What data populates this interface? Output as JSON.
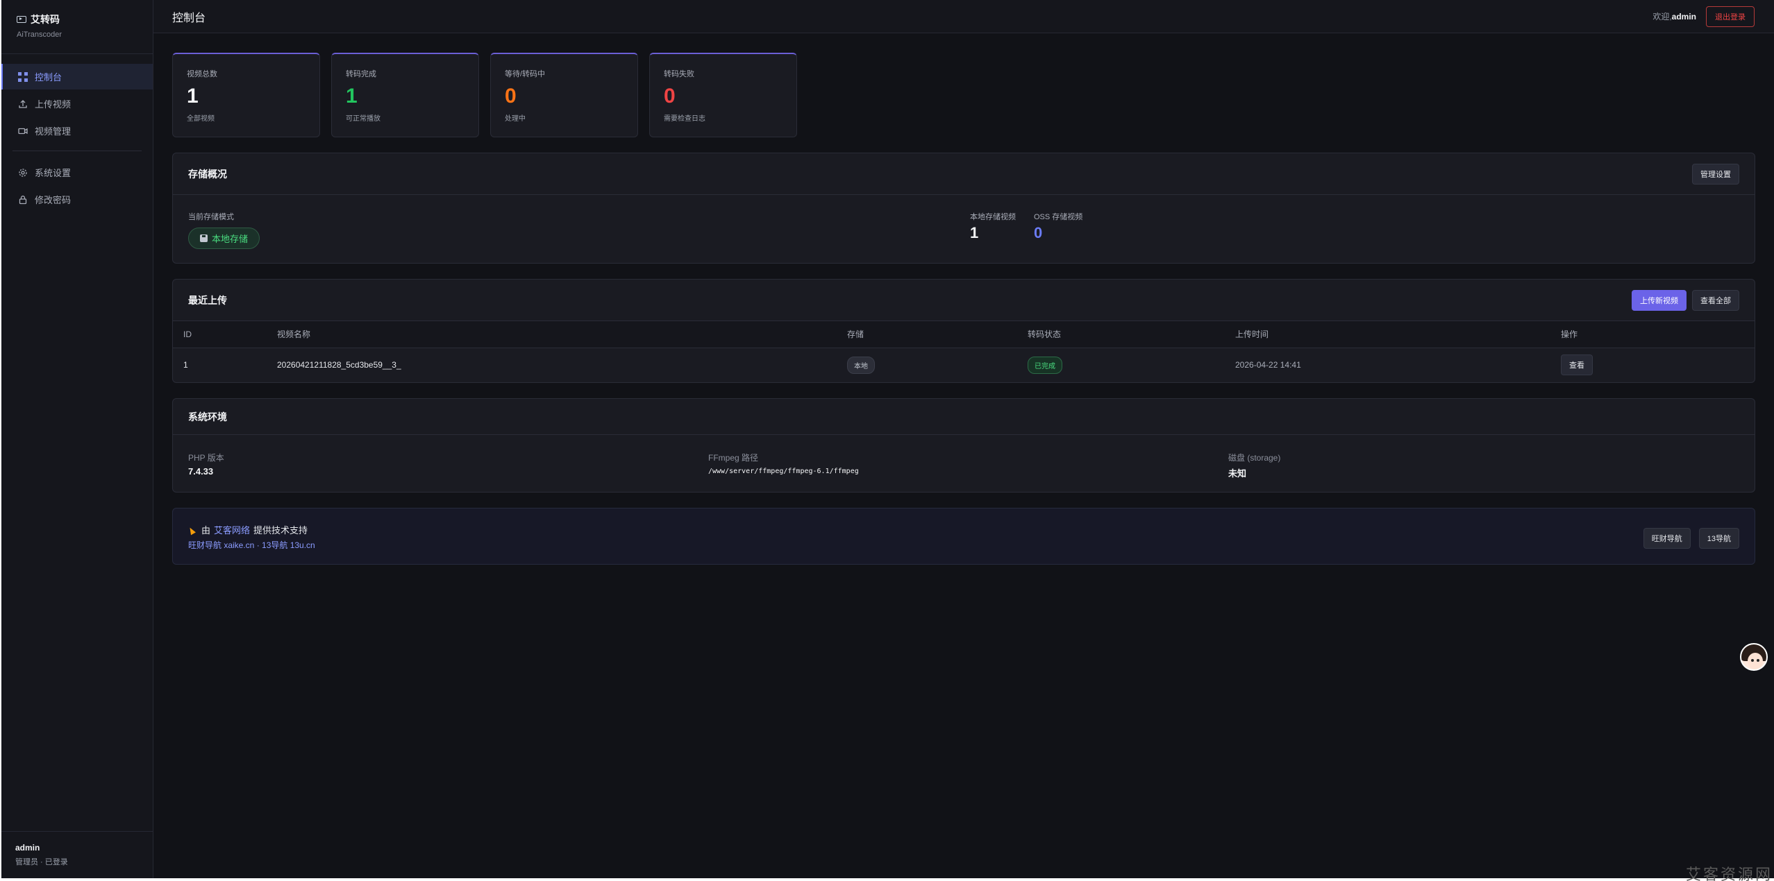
{
  "brand": {
    "title": "艾转码",
    "subtitle": "AiTranscoder"
  },
  "nav": {
    "items": [
      {
        "label": "控制台",
        "icon": "dashboard-icon"
      },
      {
        "label": "上传视频",
        "icon": "upload-icon"
      },
      {
        "label": "视频管理",
        "icon": "video-icon"
      },
      {
        "label": "系统设置",
        "icon": "gear-icon"
      },
      {
        "label": "修改密码",
        "icon": "lock-icon"
      }
    ]
  },
  "sidebar_footer": {
    "name": "admin",
    "role": "管理员 · 已登录"
  },
  "topbar": {
    "title": "控制台",
    "welcome": "欢迎,",
    "user": "admin",
    "logout": "退出登录"
  },
  "stats": [
    {
      "label": "视频总数",
      "value": "1",
      "note": "全部视频",
      "color": "#f3f4f6"
    },
    {
      "label": "转码完成",
      "value": "1",
      "note": "可正常播放",
      "color": "#22c55e"
    },
    {
      "label": "等待/转码中",
      "value": "0",
      "note": "处理中",
      "color": "#f97316"
    },
    {
      "label": "转码失败",
      "value": "0",
      "note": "需要检查日志",
      "color": "#ef4444"
    }
  ],
  "storage": {
    "title": "存储概况",
    "manage_button": "管理设置",
    "mode_label": "当前存储模式",
    "mode_value": "本地存储",
    "local_label": "本地存储视频",
    "local_count": "1",
    "oss_label": "OSS 存储视频",
    "oss_count": "0"
  },
  "recent": {
    "title": "最近上传",
    "upload_button": "上传新视频",
    "view_all_button": "查看全部",
    "columns": [
      "ID",
      "视频名称",
      "存储",
      "转码状态",
      "上传时间",
      "操作"
    ],
    "rows": [
      {
        "id": "1",
        "name": "20260421211828_5cd3be59__3_",
        "storage": "本地",
        "status": "已完成",
        "time": "2026-04-22 14:41",
        "action": "查看"
      }
    ]
  },
  "env": {
    "title": "系统环境",
    "php_label": "PHP 版本",
    "php_value": "7.4.33",
    "ffmpeg_label": "FFmpeg 路径",
    "ffmpeg_value": "/www/server/ffmpeg/ffmpeg-6.1/ffmpeg",
    "disk_label": "磁盘 (storage)",
    "disk_value": "未知"
  },
  "support": {
    "prefix": "由",
    "company": "艾客网络",
    "suffix": "提供技术支持",
    "links": "旺财导航 xaike.cn · 13导航 13u.cn",
    "btn1": "旺财导航",
    "btn2": "13导航"
  },
  "watermark": "艾客资源网",
  "colors": {
    "accent": "#6b63e8",
    "success": "#22c55e",
    "warning": "#f97316",
    "danger": "#ef4444",
    "info": "#6b7cf6"
  }
}
